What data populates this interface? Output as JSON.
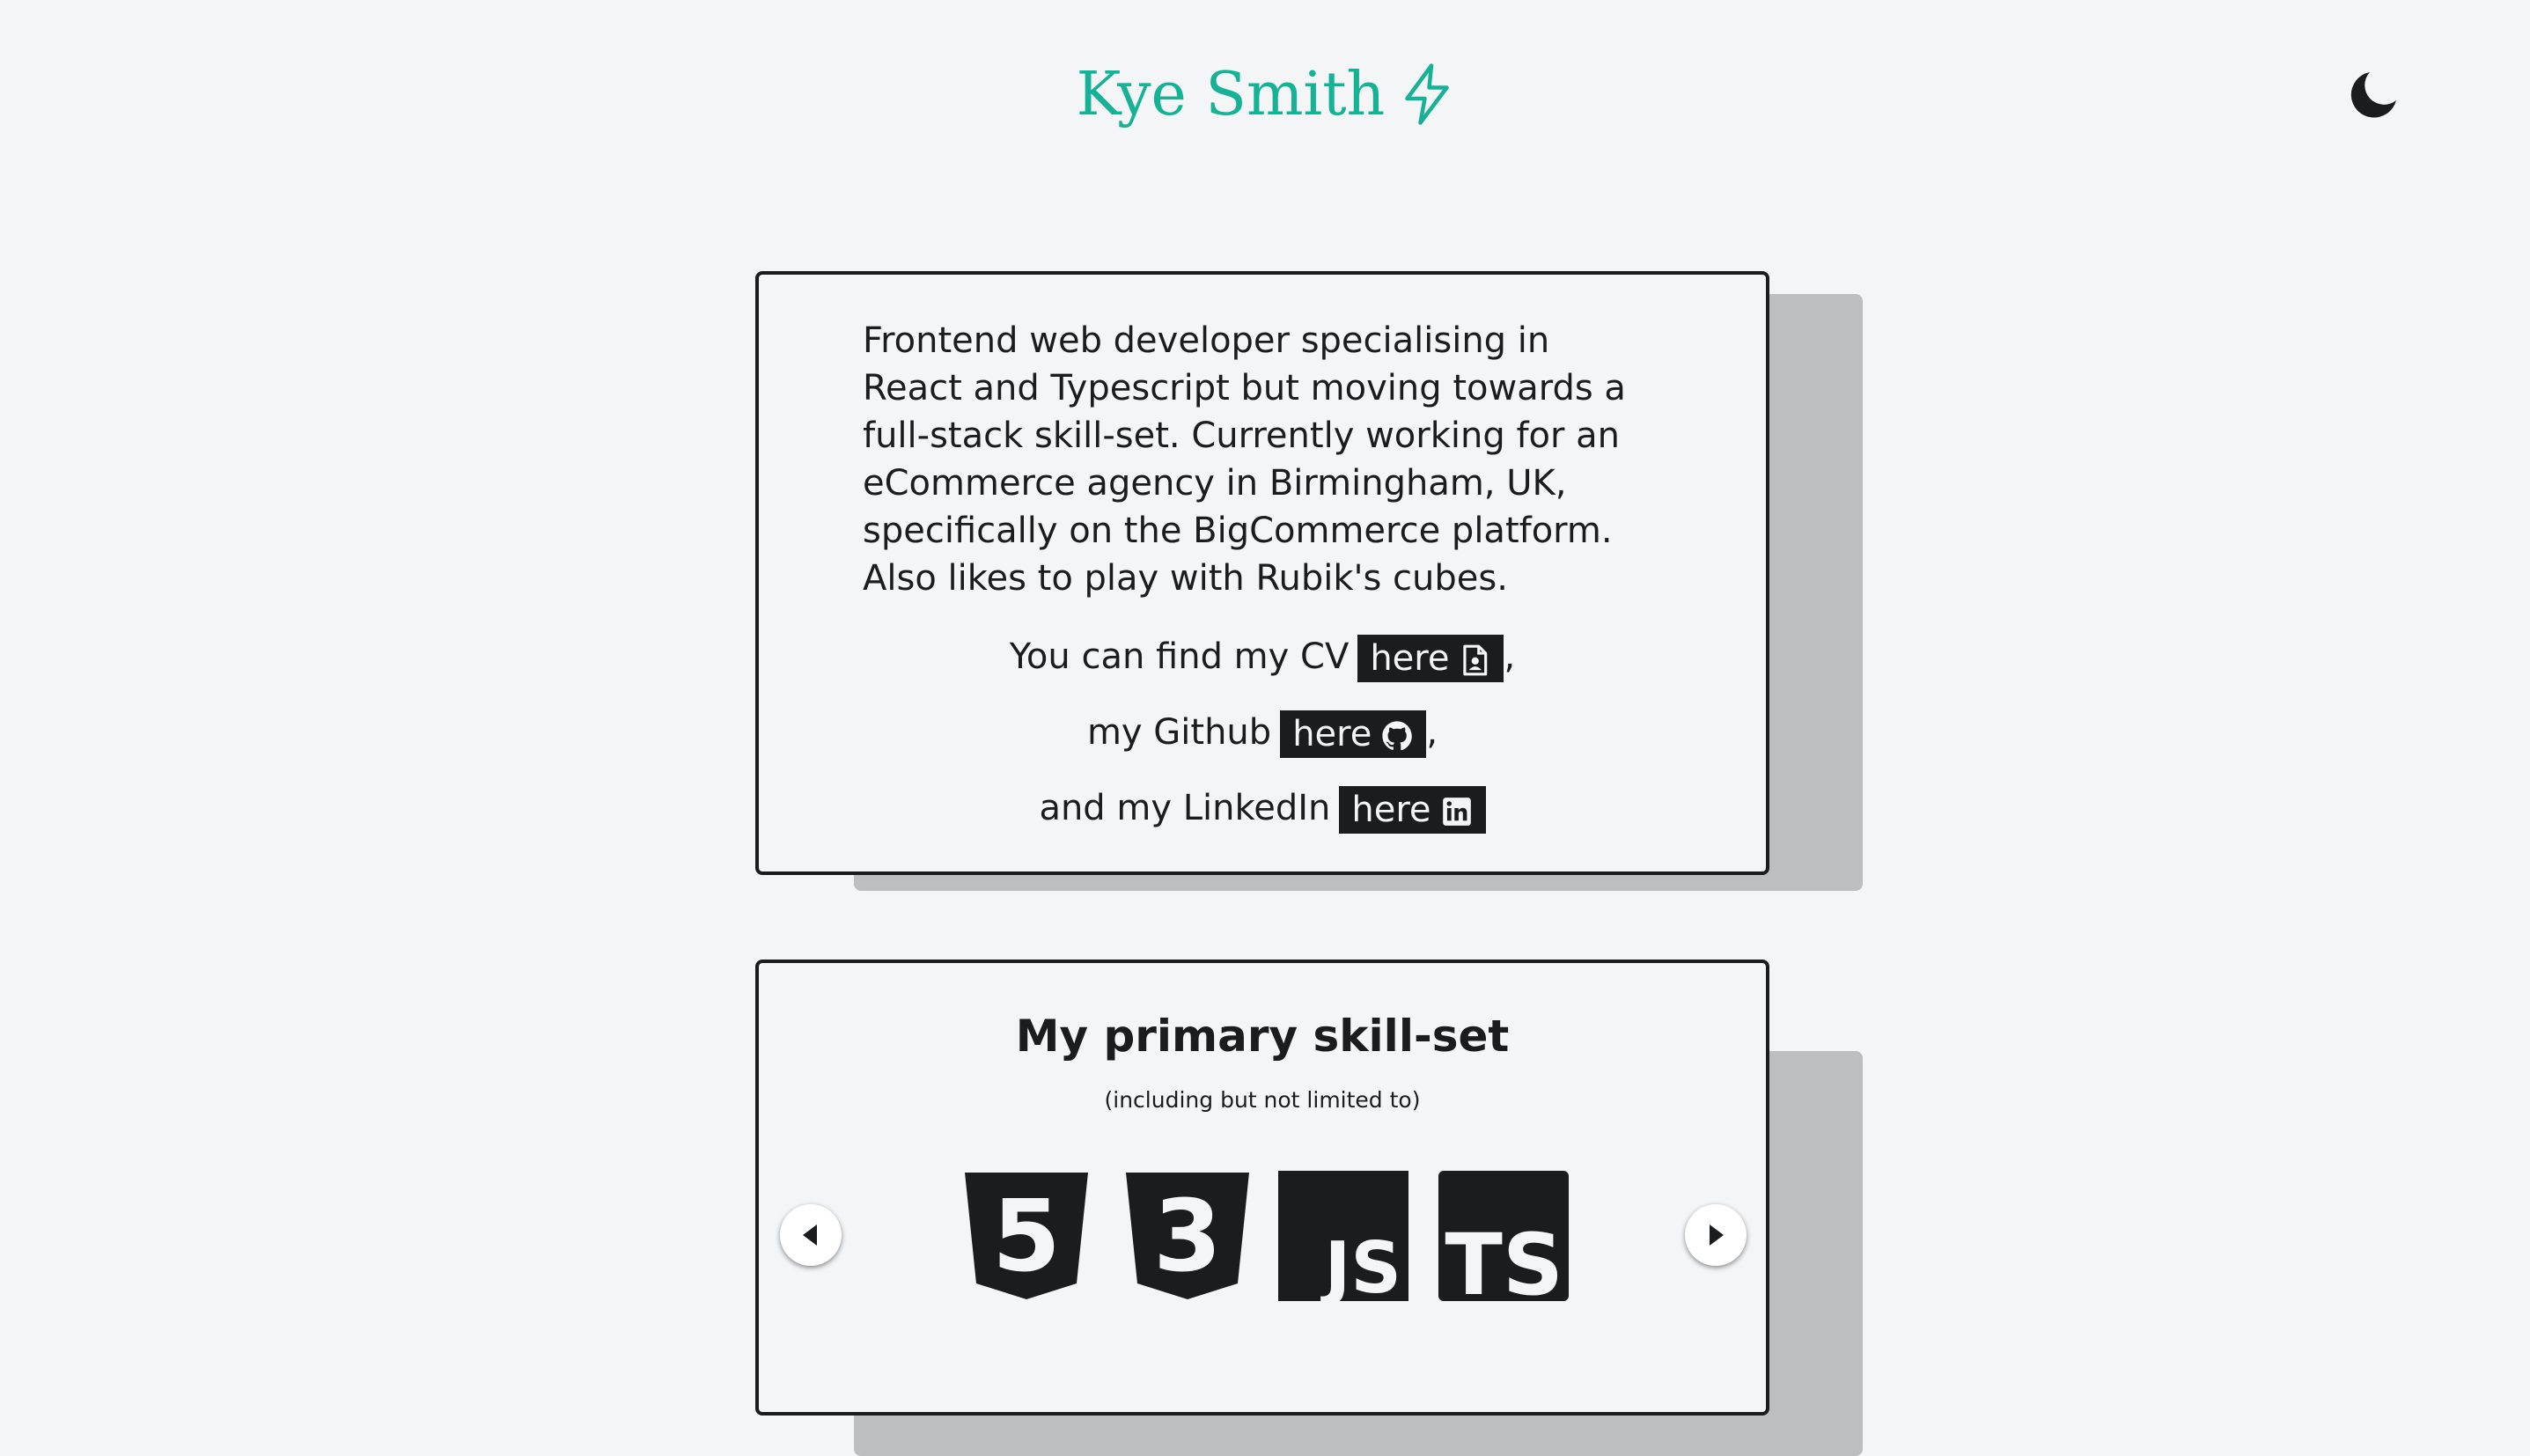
{
  "header": {
    "title": "Kye Smith",
    "title_icon": "lightning-bolt-icon",
    "theme_toggle_icon": "moon-icon"
  },
  "intro": {
    "bio": "Frontend web developer specialising in React and Typescript but moving towards a full-stack skill-set. Currently working for an eCommerce agency in Birmingham, UK, specifically on the BigCommerce platform. Also likes to play with Rubik's cubes.",
    "cv_prefix": "You can find my CV",
    "cv_link": "here",
    "cv_icon": "document-user-icon",
    "github_prefix": "my Github",
    "github_link": "here",
    "github_icon": "github-icon",
    "linkedin_prefix": "and my LinkedIn",
    "linkedin_link": "here",
    "linkedin_icon": "linkedin-icon",
    "comma": ","
  },
  "skills": {
    "title": "My primary skill-set",
    "subtitle": "(including but not limited to)",
    "logos": [
      "html5-icon",
      "css3-icon",
      "javascript-icon",
      "typescript-icon"
    ],
    "js_label": "JS",
    "ts_label": "TS",
    "html_label": "5",
    "css_label": "3",
    "prev_icon": "arrow-left-icon",
    "next_icon": "arrow-right-icon"
  },
  "colors": {
    "accent": "#16b295",
    "background": "#f4f5f7",
    "ink": "#1b1c1e",
    "shadow": "#bdbec0"
  }
}
